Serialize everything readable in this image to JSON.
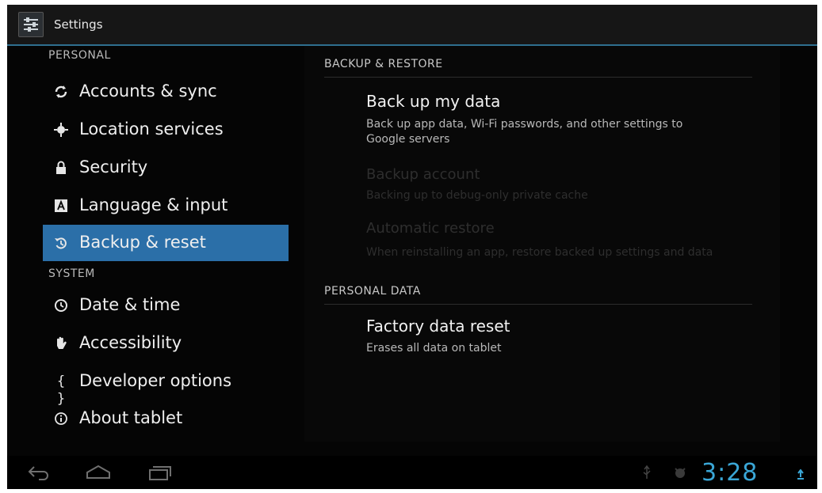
{
  "app": {
    "title": "Settings"
  },
  "sidebar": {
    "sections": [
      {
        "header": "PERSONAL"
      },
      {
        "header": "SYSTEM"
      }
    ],
    "items": [
      {
        "label": "Accounts & sync",
        "icon": "sync-icon"
      },
      {
        "label": "Location services",
        "icon": "location-icon"
      },
      {
        "label": "Security",
        "icon": "lock-icon"
      },
      {
        "label": "Language & input",
        "icon": "keyboard-icon"
      },
      {
        "label": "Backup & reset",
        "icon": "backup-icon",
        "selected": true
      },
      {
        "label": "Date & time",
        "icon": "clock-icon"
      },
      {
        "label": "Accessibility",
        "icon": "hand-icon"
      },
      {
        "label": "Developer options",
        "icon": "braces-icon"
      },
      {
        "label": "About tablet",
        "icon": "info-icon"
      }
    ]
  },
  "main": {
    "backup_section": "BACKUP & RESTORE",
    "prefs": [
      {
        "title": "Back up my data",
        "summary": "Back up app data, Wi-Fi passwords, and other settings to Google servers",
        "enabled": true
      },
      {
        "title": "Backup account",
        "summary": "Backing up to debug-only private cache",
        "enabled": false
      },
      {
        "title": "Automatic restore",
        "summary": "When reinstalling an app, restore backed up settings and data",
        "enabled": false
      }
    ],
    "personal_section": "PERSONAL DATA",
    "factory": {
      "title": "Factory data reset",
      "summary": "Erases all data on tablet"
    }
  },
  "status": {
    "clock": "3:28"
  },
  "colors": {
    "accent": "#2b6fa8",
    "clock": "#3aa6d6"
  }
}
